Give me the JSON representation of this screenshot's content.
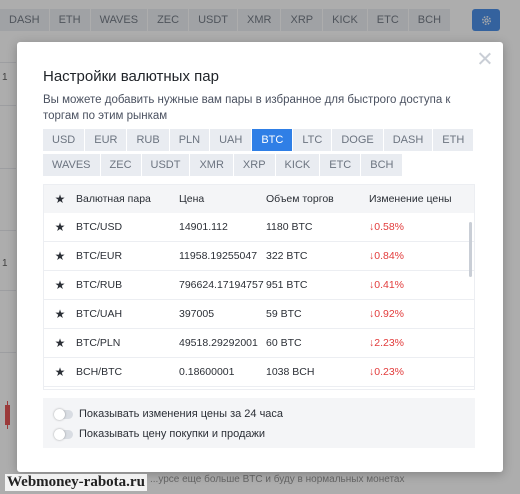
{
  "background": {
    "tabs": [
      "DASH",
      "ETH",
      "WAVES",
      "ZEC",
      "USDT",
      "XMR",
      "XRP",
      "KICK",
      "ETC",
      "BCH"
    ],
    "left_numbers": [
      "1",
      "1"
    ],
    "bottom_text": "...урсе еще больше BTC и буду в нормальных монетах"
  },
  "watermark": "Webmoney-rabota.ru",
  "modal": {
    "title": "Настройки валютных пар",
    "description": "Вы можете добавить нужные вам пары в избранное для быстрого доступа к торгам по этим рынкам",
    "currencies_row1": [
      {
        "label": "USD",
        "active": false
      },
      {
        "label": "EUR",
        "active": false
      },
      {
        "label": "RUB",
        "active": false
      },
      {
        "label": "PLN",
        "active": false
      },
      {
        "label": "UAH",
        "active": false
      },
      {
        "label": "BTC",
        "active": true
      },
      {
        "label": "LTC",
        "active": false
      },
      {
        "label": "DOGE",
        "active": false
      },
      {
        "label": "DASH",
        "active": false
      },
      {
        "label": "ETH",
        "active": false
      }
    ],
    "currencies_row2": [
      {
        "label": "WAVES",
        "active": false
      },
      {
        "label": "ZEC",
        "active": false
      },
      {
        "label": "USDT",
        "active": false
      },
      {
        "label": "XMR",
        "active": false
      },
      {
        "label": "XRP",
        "active": false
      },
      {
        "label": "KICK",
        "active": false
      },
      {
        "label": "ETC",
        "active": false
      },
      {
        "label": "BCH",
        "active": false
      }
    ],
    "table": {
      "headers": {
        "pair": "Валютная пара",
        "price": "Цена",
        "volume": "Объем торгов",
        "change": "Изменение цены"
      },
      "rows": [
        {
          "pair": "BTC/USD",
          "price": "14901.112",
          "volume": "1180 BTC",
          "change": "↓0.58%"
        },
        {
          "pair": "BTC/EUR",
          "price": "11958.19255047",
          "volume": "322 BTC",
          "change": "↓0.84%"
        },
        {
          "pair": "BTC/RUB",
          "price": "796624.17194757",
          "volume": "951 BTC",
          "change": "↓0.41%"
        },
        {
          "pair": "BTC/UAH",
          "price": "397005",
          "volume": "59 BTC",
          "change": "↓0.92%"
        },
        {
          "pair": "BTC/PLN",
          "price": "49518.29292001",
          "volume": "60 BTC",
          "change": "↓2.23%"
        },
        {
          "pair": "BCH/BTC",
          "price": "0.18600001",
          "volume": "1038 BCH",
          "change": "↓0.23%"
        }
      ]
    },
    "toggles": [
      {
        "label": "Показывать изменения цены за 24 часа",
        "on": false
      },
      {
        "label": "Показывать цену покупки и продажи",
        "on": false
      }
    ]
  },
  "colors": {
    "accent": "#2f7fe6",
    "negative": "#e23b3b"
  }
}
